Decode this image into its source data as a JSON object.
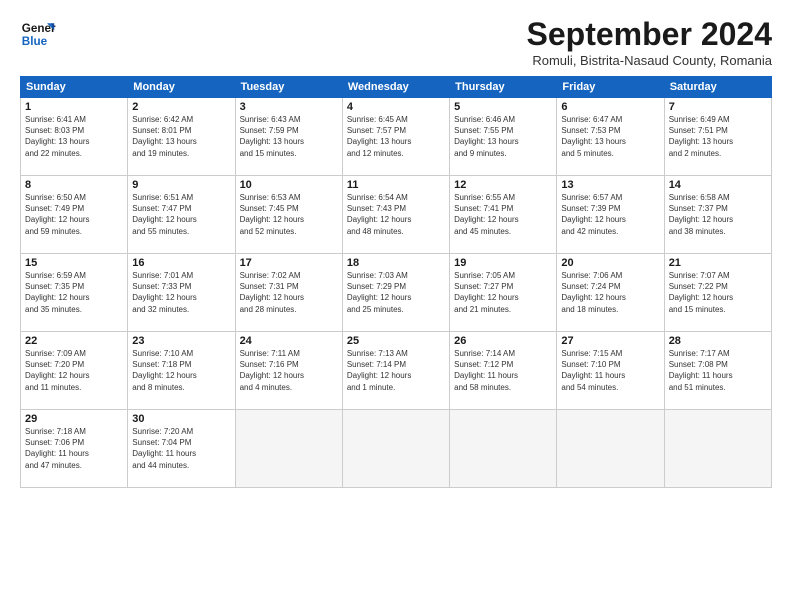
{
  "header": {
    "logo_line1": "General",
    "logo_line2": "Blue",
    "month_title": "September 2024",
    "subtitle": "Romuli, Bistrita-Nasaud County, Romania"
  },
  "weekdays": [
    "Sunday",
    "Monday",
    "Tuesday",
    "Wednesday",
    "Thursday",
    "Friday",
    "Saturday"
  ],
  "weeks": [
    [
      {
        "day": "1",
        "info": "Sunrise: 6:41 AM\nSunset: 8:03 PM\nDaylight: 13 hours\nand 22 minutes."
      },
      {
        "day": "2",
        "info": "Sunrise: 6:42 AM\nSunset: 8:01 PM\nDaylight: 13 hours\nand 19 minutes."
      },
      {
        "day": "3",
        "info": "Sunrise: 6:43 AM\nSunset: 7:59 PM\nDaylight: 13 hours\nand 15 minutes."
      },
      {
        "day": "4",
        "info": "Sunrise: 6:45 AM\nSunset: 7:57 PM\nDaylight: 13 hours\nand 12 minutes."
      },
      {
        "day": "5",
        "info": "Sunrise: 6:46 AM\nSunset: 7:55 PM\nDaylight: 13 hours\nand 9 minutes."
      },
      {
        "day": "6",
        "info": "Sunrise: 6:47 AM\nSunset: 7:53 PM\nDaylight: 13 hours\nand 5 minutes."
      },
      {
        "day": "7",
        "info": "Sunrise: 6:49 AM\nSunset: 7:51 PM\nDaylight: 13 hours\nand 2 minutes."
      }
    ],
    [
      {
        "day": "8",
        "info": "Sunrise: 6:50 AM\nSunset: 7:49 PM\nDaylight: 12 hours\nand 59 minutes."
      },
      {
        "day": "9",
        "info": "Sunrise: 6:51 AM\nSunset: 7:47 PM\nDaylight: 12 hours\nand 55 minutes."
      },
      {
        "day": "10",
        "info": "Sunrise: 6:53 AM\nSunset: 7:45 PM\nDaylight: 12 hours\nand 52 minutes."
      },
      {
        "day": "11",
        "info": "Sunrise: 6:54 AM\nSunset: 7:43 PM\nDaylight: 12 hours\nand 48 minutes."
      },
      {
        "day": "12",
        "info": "Sunrise: 6:55 AM\nSunset: 7:41 PM\nDaylight: 12 hours\nand 45 minutes."
      },
      {
        "day": "13",
        "info": "Sunrise: 6:57 AM\nSunset: 7:39 PM\nDaylight: 12 hours\nand 42 minutes."
      },
      {
        "day": "14",
        "info": "Sunrise: 6:58 AM\nSunset: 7:37 PM\nDaylight: 12 hours\nand 38 minutes."
      }
    ],
    [
      {
        "day": "15",
        "info": "Sunrise: 6:59 AM\nSunset: 7:35 PM\nDaylight: 12 hours\nand 35 minutes."
      },
      {
        "day": "16",
        "info": "Sunrise: 7:01 AM\nSunset: 7:33 PM\nDaylight: 12 hours\nand 32 minutes."
      },
      {
        "day": "17",
        "info": "Sunrise: 7:02 AM\nSunset: 7:31 PM\nDaylight: 12 hours\nand 28 minutes."
      },
      {
        "day": "18",
        "info": "Sunrise: 7:03 AM\nSunset: 7:29 PM\nDaylight: 12 hours\nand 25 minutes."
      },
      {
        "day": "19",
        "info": "Sunrise: 7:05 AM\nSunset: 7:27 PM\nDaylight: 12 hours\nand 21 minutes."
      },
      {
        "day": "20",
        "info": "Sunrise: 7:06 AM\nSunset: 7:24 PM\nDaylight: 12 hours\nand 18 minutes."
      },
      {
        "day": "21",
        "info": "Sunrise: 7:07 AM\nSunset: 7:22 PM\nDaylight: 12 hours\nand 15 minutes."
      }
    ],
    [
      {
        "day": "22",
        "info": "Sunrise: 7:09 AM\nSunset: 7:20 PM\nDaylight: 12 hours\nand 11 minutes."
      },
      {
        "day": "23",
        "info": "Sunrise: 7:10 AM\nSunset: 7:18 PM\nDaylight: 12 hours\nand 8 minutes."
      },
      {
        "day": "24",
        "info": "Sunrise: 7:11 AM\nSunset: 7:16 PM\nDaylight: 12 hours\nand 4 minutes."
      },
      {
        "day": "25",
        "info": "Sunrise: 7:13 AM\nSunset: 7:14 PM\nDaylight: 12 hours\nand 1 minute."
      },
      {
        "day": "26",
        "info": "Sunrise: 7:14 AM\nSunset: 7:12 PM\nDaylight: 11 hours\nand 58 minutes."
      },
      {
        "day": "27",
        "info": "Sunrise: 7:15 AM\nSunset: 7:10 PM\nDaylight: 11 hours\nand 54 minutes."
      },
      {
        "day": "28",
        "info": "Sunrise: 7:17 AM\nSunset: 7:08 PM\nDaylight: 11 hours\nand 51 minutes."
      }
    ],
    [
      {
        "day": "29",
        "info": "Sunrise: 7:18 AM\nSunset: 7:06 PM\nDaylight: 11 hours\nand 47 minutes."
      },
      {
        "day": "30",
        "info": "Sunrise: 7:20 AM\nSunset: 7:04 PM\nDaylight: 11 hours\nand 44 minutes."
      },
      {
        "day": "",
        "info": ""
      },
      {
        "day": "",
        "info": ""
      },
      {
        "day": "",
        "info": ""
      },
      {
        "day": "",
        "info": ""
      },
      {
        "day": "",
        "info": ""
      }
    ]
  ]
}
